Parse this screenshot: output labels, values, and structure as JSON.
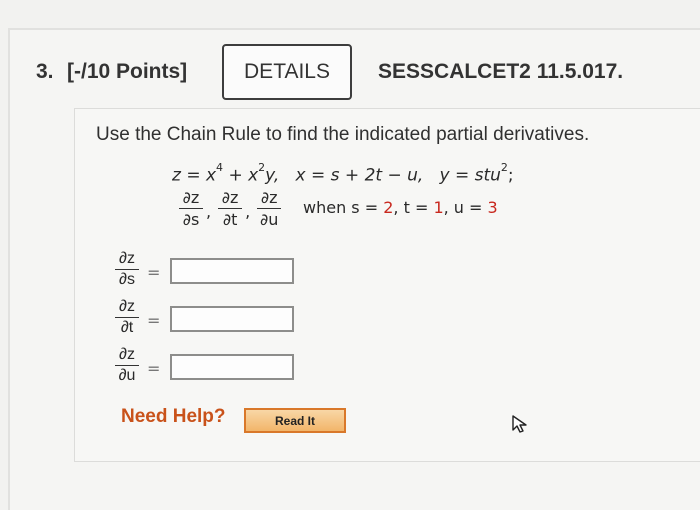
{
  "header": {
    "question_number": "3.",
    "points": "[-/10 Points]",
    "details_label": "DETAILS",
    "course_code": "SESSCALCET2 11.5.017."
  },
  "problem": {
    "instructions": "Use the Chain Rule to find the indicated partial derivatives.",
    "z_def": "z = x",
    "z_exp1": "4",
    "z_mid": " + x",
    "z_exp2": "2",
    "z_end": "y,",
    "x_def": "x = s + 2t − u,",
    "y_def": "y = stu",
    "y_exp": "2",
    "y_end": ";",
    "when_prefix": "when s = ",
    "s_val": "2",
    "t_label": ", t = ",
    "t_val": "1",
    "u_label": ", u = ",
    "u_val": "3",
    "partial_num": "∂z",
    "ds": "∂s",
    "dt": "∂t",
    "du": "∂u",
    "comma": ","
  },
  "answers": [
    {
      "num": "∂z",
      "den": "∂s",
      "eq": "=",
      "value": ""
    },
    {
      "num": "∂z",
      "den": "∂t",
      "eq": "=",
      "value": ""
    },
    {
      "num": "∂z",
      "den": "∂u",
      "eq": "=",
      "value": ""
    }
  ],
  "help": {
    "need_help": "Need Help?",
    "read_it": "Read It"
  },
  "icons": {
    "cursor": "mouse-cursor-icon"
  }
}
